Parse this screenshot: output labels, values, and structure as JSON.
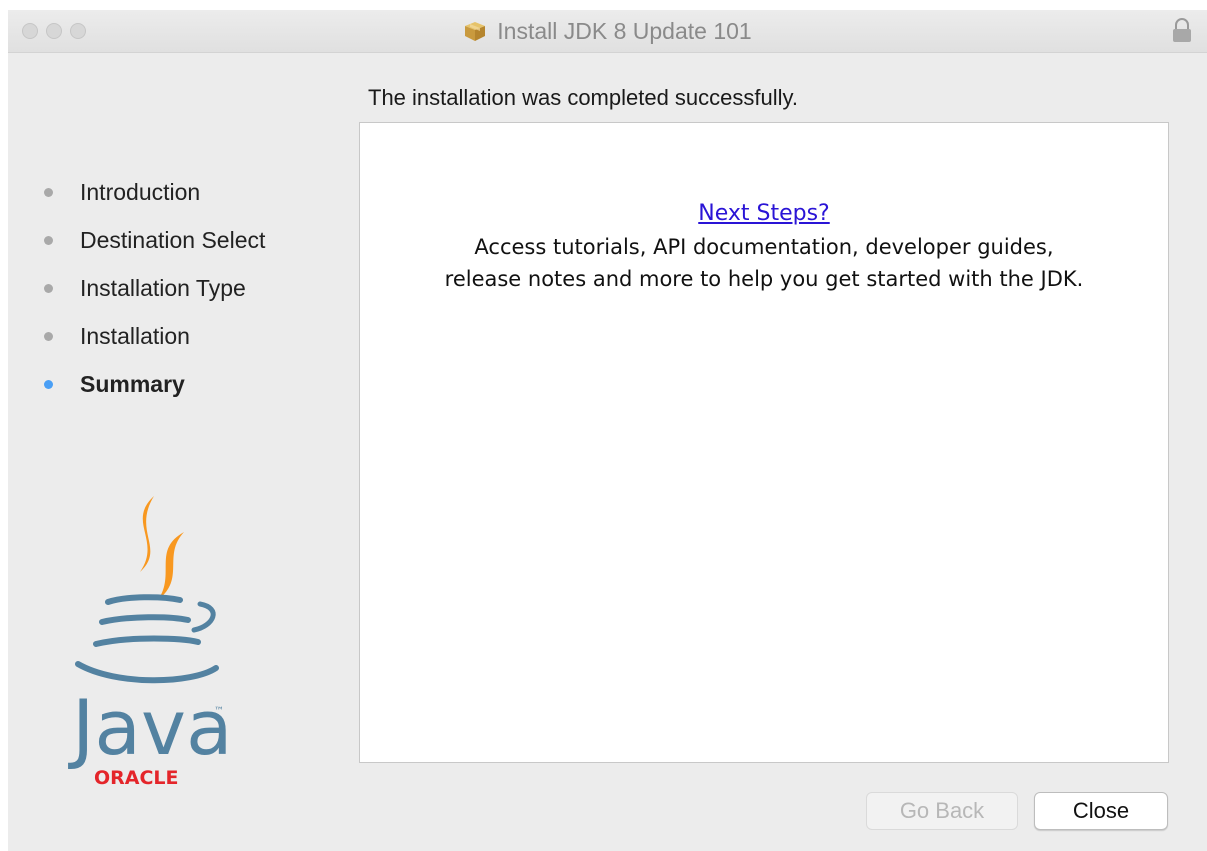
{
  "window": {
    "title": "Install JDK 8 Update 101"
  },
  "heading": "The installation was completed successfully.",
  "sidebar": {
    "steps": [
      {
        "label": "Introduction",
        "active": false
      },
      {
        "label": "Destination Select",
        "active": false
      },
      {
        "label": "Installation Type",
        "active": false
      },
      {
        "label": "Installation",
        "active": false
      },
      {
        "label": "Summary",
        "active": true
      }
    ]
  },
  "content": {
    "link_text": "Next Steps?",
    "body_line1": "Access tutorials, API documentation, developer guides,",
    "body_line2": "release notes and more to help you get started with the JDK."
  },
  "logo": {
    "wordmark": "Java",
    "trademark": "™",
    "vendor": "ORACLE"
  },
  "buttons": {
    "go_back": "Go Back",
    "close": "Close"
  },
  "colors": {
    "active_step": "#4a9ff5",
    "link": "#2a14d6",
    "java_blue": "#5382a1",
    "java_orange": "#f89820",
    "oracle_red": "#e4252a"
  }
}
